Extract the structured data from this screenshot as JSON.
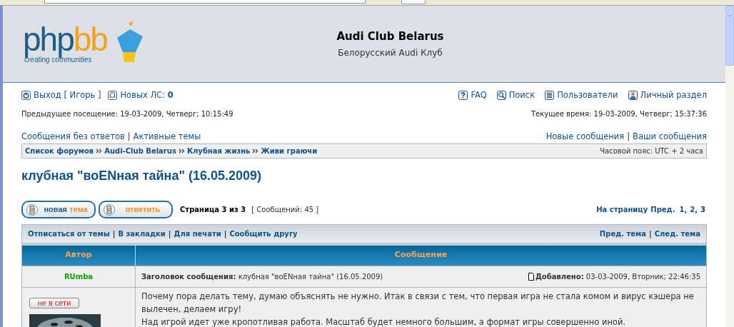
{
  "header": {
    "logo": {
      "wordmark_1": "php",
      "wordmark_2": "bb",
      "tagline": "creating communities"
    },
    "site_title": "Audi Club Belarus",
    "site_description": "Белорусский Audi Клуб"
  },
  "user_nav": [
    {
      "kind": "logout",
      "label": "Выход [ Игорь ]"
    },
    {
      "kind": "pm",
      "label": "Новых ЛС: ",
      "count": "0"
    }
  ],
  "main_nav": [
    {
      "kind": "faq",
      "label": "FAQ"
    },
    {
      "kind": "search",
      "label": "Поиск"
    },
    {
      "kind": "members",
      "label": "Пользователи"
    },
    {
      "kind": "profile",
      "label": "Личный раздел"
    }
  ],
  "last_visit": "Предыдущее посещение: 19-03-2009, Четверг; 10:15:49",
  "current_time": "Текущее время: 19-03-2009, Четверг; 15:37:36",
  "separator": "|",
  "search_links_left": [
    "Сообщения без ответов",
    "Активные темы"
  ],
  "search_links_right": [
    "Новые сообщения",
    "Ваши сообщения"
  ],
  "breadcrumbs": [
    "Список форумов",
    "Audi-Club Belarus",
    "Клубная жизнь",
    "Живи граючи"
  ],
  "timezone": "Часовой пояс: UTC + 2 часа",
  "topic_title": "клубная \"воENная тайна\" (16.05.2009)",
  "buttons": [
    {
      "label": "новая",
      "accent": "тема"
    },
    {
      "accent": "ответить"
    }
  ],
  "page_info": {
    "label": "Страница 3 из 3",
    "count": "[ Сообщений: 45 ]"
  },
  "pagination": {
    "label": "На страницу",
    "prev": "Пред.",
    "separator": ",",
    "pages": [
      {
        "label": "1",
        "selected": false
      },
      {
        "label": "2",
        "selected": false
      },
      {
        "label": "3",
        "selected": true
      }
    ]
  },
  "topic_actions": [
    "Отписаться от темы",
    "В закладки",
    "Для печати",
    "Сообщить другу"
  ],
  "topic_nav": [
    "Пред. тема",
    "След. тема"
  ],
  "table": {
    "columns": [
      "Автор",
      "Сообщение"
    ],
    "post": {
      "author": "RUmba",
      "subject_label": "Заголовок сообщения:",
      "subject": "клубная \"воENная тайна\" (16.05.2009)",
      "posted_label": "Добавлено:",
      "posted": "03-03-2009, Вторник; 22:46:35",
      "online": false,
      "status": "не в сети",
      "body": [
        "Почему пора делать тему, думаю объяснять не нужно. Итак в связи с тем, что первая игра не стала комом и вирус кэшера не вылечен, делаем игру!",
        "Над игрой идет уже кропотливая работа. Масштаб будет немного большим, а формат игры совершенно иной."
      ]
    }
  }
}
